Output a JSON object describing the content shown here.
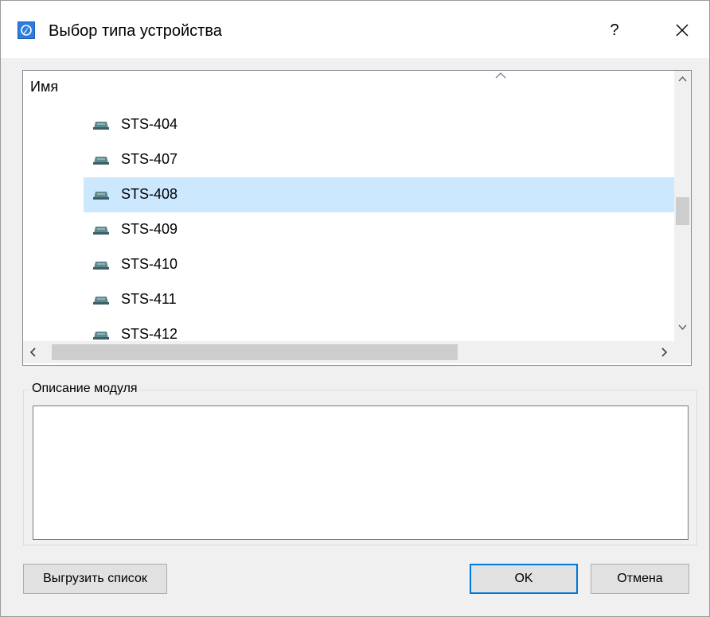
{
  "window": {
    "title": "Выбор типа устройства",
    "help_label": "?",
    "icons": {
      "app": "compass-app-icon",
      "close": "close-icon"
    }
  },
  "list": {
    "column_header": "Имя",
    "selected_index": 2,
    "items": [
      {
        "label": "STS-404",
        "icon": "device-module-icon"
      },
      {
        "label": "STS-407",
        "icon": "device-module-icon"
      },
      {
        "label": "STS-408",
        "icon": "device-module-icon"
      },
      {
        "label": "STS-409",
        "icon": "device-module-icon"
      },
      {
        "label": "STS-410",
        "icon": "device-module-icon"
      },
      {
        "label": "STS-411",
        "icon": "device-module-icon"
      },
      {
        "label": "STS-412",
        "icon": "device-module-icon"
      }
    ]
  },
  "description": {
    "group_title": "Описание модуля",
    "text": ""
  },
  "buttons": {
    "export_label": "Выгрузить список",
    "ok_label": "OK",
    "cancel_label": "Отмена"
  },
  "colors": {
    "selection": "#cce8ff",
    "focus_border": "#0078d7",
    "icon_blue": "#2d7de0"
  }
}
